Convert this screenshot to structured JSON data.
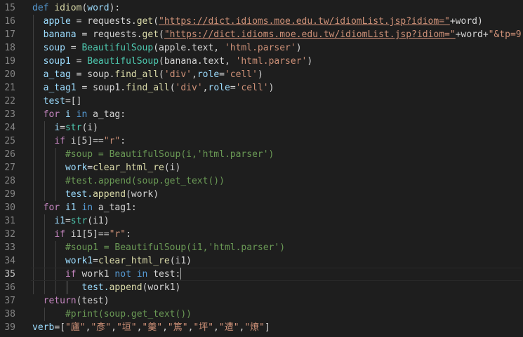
{
  "editor": {
    "current_line": 35,
    "line_numbers": [
      "15",
      "16",
      "17",
      "18",
      "19",
      "20",
      "21",
      "22",
      "23",
      "24",
      "25",
      "26",
      "27",
      "28",
      "29",
      "30",
      "31",
      "32",
      "33",
      "34",
      "35",
      "36",
      "37",
      "38",
      "39"
    ]
  },
  "code": {
    "l15": {
      "kw": "def",
      "name": "idiom",
      "open": "(",
      "param": "word",
      "close": "):"
    },
    "l16": {
      "a": "apple",
      "b": " = requests.",
      "fn": "get",
      "c": "(",
      "url": "\"https://dict.idioms.moe.edu.tw/idiomList.jsp?idiom=\"",
      "d": "+word)"
    },
    "l17": {
      "a": "banana",
      "b": " = requests.",
      "fn": "get",
      "c": "(",
      "url": "\"https://dict.idioms.moe.edu.tw/idiomList.jsp?idiom=\"",
      "d": "+word+",
      "s": "\"&tp=9\"",
      "e": ")"
    },
    "l18": {
      "a": "soup",
      "b": " = ",
      "fn": "BeautifulSoup",
      "c": "(apple.text, ",
      "s": "'html.parser'",
      "d": ")"
    },
    "l19": {
      "a": "soup1",
      "b": " = ",
      "fn": "BeautifulSoup",
      "c": "(banana.text, ",
      "s": "'html.parser'",
      "d": ")"
    },
    "l20": {
      "a": "a_tag",
      "b": " = soup.",
      "fn": "find_all",
      "c": "(",
      "s1": "'div'",
      "d": ",",
      "kw": "role",
      "e": "=",
      "s2": "'cell'",
      "f": ")"
    },
    "l21": {
      "a": "a_tag1",
      "b": " = soup1.",
      "fn": "find_all",
      "c": "(",
      "s1": "'div'",
      "d": ",",
      "kw": "role",
      "e": "=",
      "s2": "'cell'",
      "f": ")"
    },
    "l22": {
      "a": "test",
      "b": "=[]"
    },
    "l23": {
      "kw": "for",
      "v": " i ",
      "in": "in",
      "rest": " a_tag:"
    },
    "l24": {
      "a": "i",
      "b": "=",
      "t": "str",
      "c": "(i)"
    },
    "l25": {
      "kw": "if",
      "a": " i[5]==",
      "s": "\"r\"",
      "b": ":"
    },
    "l26": {
      "cm": "#soup = BeautifulSoup(i,'html.parser')"
    },
    "l27": {
      "a": "work",
      "b": "=",
      "fn": "clear_html_re",
      "c": "(i)"
    },
    "l28": {
      "cm": "#test.append(soup.get_text())"
    },
    "l29": {
      "a": "test.",
      "fn": "append",
      "c": "(work)"
    },
    "l30": {
      "kw": "for",
      "v": " i1 ",
      "in": "in",
      "rest": " a_tag1:"
    },
    "l31": {
      "a": "i1",
      "b": "=",
      "t": "str",
      "c": "(i1)"
    },
    "l32": {
      "kw": "if",
      "a": " i1[5]==",
      "s": "\"r\"",
      "b": ":"
    },
    "l33": {
      "cm": "#soup1 = BeautifulSoup(i1,'html.parser')"
    },
    "l34": {
      "a": "work1",
      "b": "=",
      "fn": "clear_html_re",
      "c": "(i1)"
    },
    "l35": {
      "kw": "if",
      "a": " work1 ",
      "not": "not",
      "sp": " ",
      "in": "in",
      "b": " test:"
    },
    "l36": {
      "a": "test.",
      "fn": "append",
      "c": "(work1)"
    },
    "l37": {
      "kw": "return",
      "c": "(test)"
    },
    "l38": {
      "cm": "#print(soup.get_text())"
    },
    "l39": {
      "a": "verb",
      "b": "=[",
      "s1": "\"廬\"",
      "s2": "\"彥\"",
      "s3": "\"垣\"",
      "s4": "\"羹\"",
      "s5": "\"篤\"",
      "s6": "\"坪\"",
      "s7": "\"遭\"",
      "s8": "\"燎\"",
      "comma": ",",
      "e": "]"
    }
  }
}
